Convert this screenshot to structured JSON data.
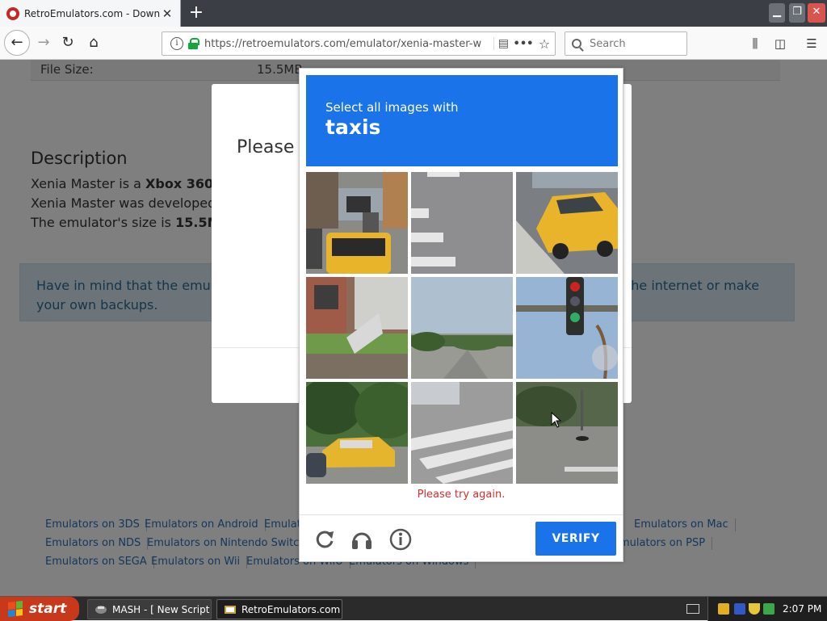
{
  "browser": {
    "tab_title": "RetroEmulators.com - Download X",
    "tab_close": "✕",
    "new_tab": "+",
    "url": "https://retroemulators.com/emulator/xenia-master-w",
    "search_placeholder": "Search"
  },
  "page": {
    "file_size_label": "File Size:",
    "file_size_value": "15.5MB",
    "description_heading": "Description",
    "desc_line1_prefix": "Xenia Master is a ",
    "desc_line1_bold": "Xbox 360",
    "desc_line1_suffix": " em",
    "desc_line2": "Xenia Master was developed b",
    "desc_line3_prefix": "The emulator's size is ",
    "desc_line3_bold": "15.5MB",
    "alert_line1_left": "Have in mind that the emulat",
    "alert_line1_right": "the internet or make",
    "alert_line2": "your own backups.",
    "links": [
      "Emulators on 3DS",
      "Emulators on Android",
      "Emulat",
      "Emulators on Mac",
      "Emulators on NDS",
      "Emulators on Nintendo Switch",
      "mulators on PSP",
      "Emulators on SEGA",
      "Emulators on Wii",
      "Emulators on WiiU",
      "Emulators on Windows"
    ]
  },
  "dialog": {
    "title": "Please v"
  },
  "captcha": {
    "instruction": "Select all images with",
    "target": "taxis",
    "error": "Please try again.",
    "verify_label": "VERIFY",
    "reload_icon": "reload-icon",
    "audio_icon": "headphones-icon",
    "info_icon": "info-icon",
    "colors": {
      "header": "#1a73e8",
      "error": "#d32f2f"
    }
  },
  "taskbar": {
    "start_label": "start",
    "tasks": [
      "MASH - [ New Script ] *",
      "RetroEmulators.com -..."
    ],
    "clock": "2:07 PM"
  }
}
